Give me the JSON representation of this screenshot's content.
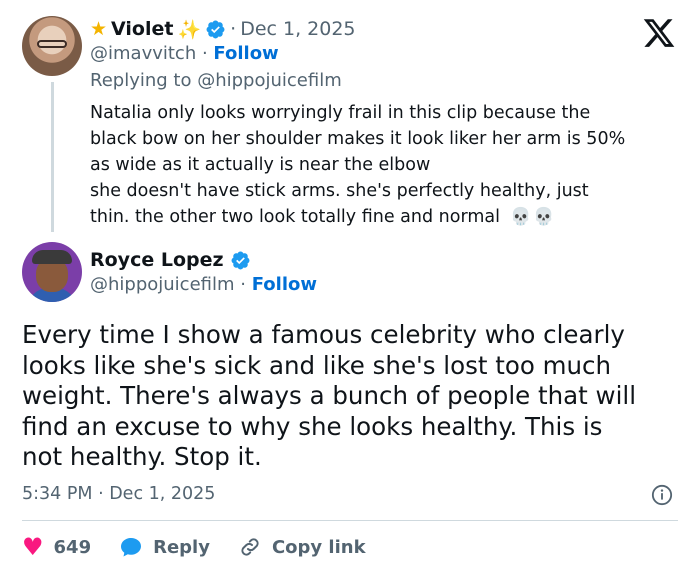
{
  "reply_tweet": {
    "name": "Violet",
    "date": "Dec 1, 2025",
    "separator": "·",
    "handle": "@imavvitch",
    "follow_label": "Follow",
    "replying_to": "Replying to @hippojuicefilm",
    "lines": [
      "Natalia only looks worryingly frail in this clip because the",
      "black bow on her shoulder makes it look liker her arm is 50%",
      "as wide as it actually is near the elbow",
      "she doesn't have stick arms. she's perfectly healthy, just",
      "thin. the other two look totally fine and normal"
    ],
    "emoji": "💀💀"
  },
  "main_tweet": {
    "name": "Royce Lopez",
    "handle": "@hippojuicefilm",
    "follow_label": "Follow",
    "separator": "·",
    "lines": [
      "Every time I show a famous celebrity who clearly",
      "looks like she's sick and like she's lost too much",
      "weight. There's always a bunch of people that will",
      "find an excuse to why she looks healthy.  This is",
      "not healthy. Stop it."
    ],
    "timestamp": "5:34 PM · Dec 1, 2025"
  },
  "actions": {
    "likes": "649",
    "reply_label": "Reply",
    "copy_link_label": "Copy link"
  },
  "icons": {
    "logo": "x-logo-icon",
    "verified": "verified-badge-icon",
    "info": "info-icon",
    "like": "heart-icon",
    "reply": "speech-bubble-icon",
    "copy_link": "link-icon"
  },
  "colors": {
    "verified": "#1d9bf0",
    "follow": "#006fd6",
    "like": "#f91880",
    "muted": "#536471",
    "text": "#0f1419"
  }
}
